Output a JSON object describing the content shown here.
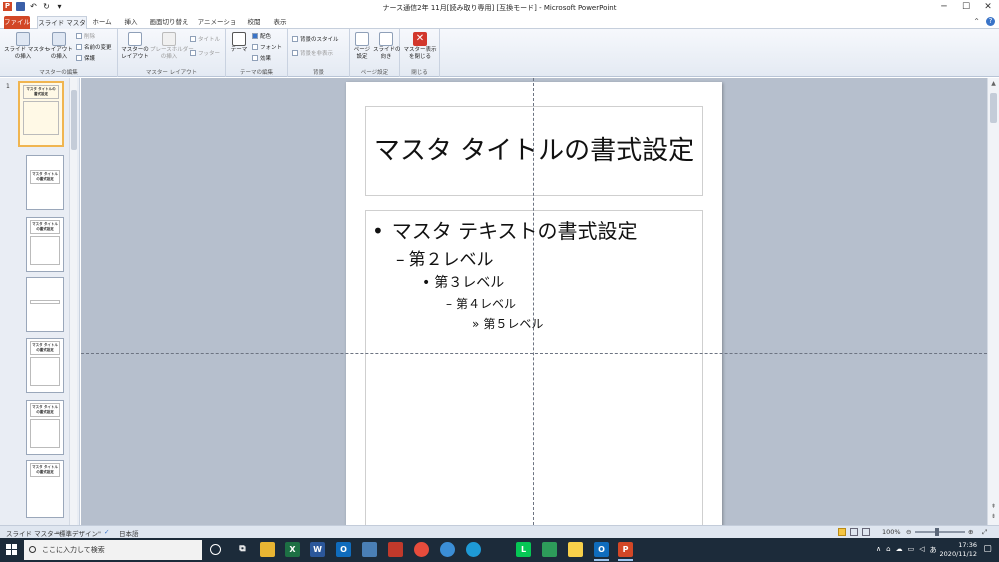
{
  "window": {
    "title": "ナース通信2年 11月[読み取り専用] [互換モード] - Microsoft PowerPoint",
    "controls": [
      "minimize",
      "maximize",
      "close"
    ]
  },
  "tabs": [
    {
      "label": "ファイル",
      "type": "file"
    },
    {
      "label": "スライド マスター",
      "type": "active"
    },
    {
      "label": "ホーム"
    },
    {
      "label": "挿入"
    },
    {
      "label": "画面切り替え"
    },
    {
      "label": "アニメーション"
    },
    {
      "label": "校閲"
    },
    {
      "label": "表示"
    }
  ],
  "ribbon": {
    "groups": [
      {
        "label": "マスターの編集"
      },
      {
        "label": "マスター レイアウト"
      },
      {
        "label": "テーマの編集"
      },
      {
        "label": "背景"
      },
      {
        "label": "ページ設定"
      },
      {
        "label": "閉じる"
      }
    ],
    "insert_slide_master": "スライド マスター\nの挿入",
    "insert_layout": "レイアウト\nの挿入",
    "delete": "削除",
    "rename": "名前の変更",
    "preserve": "保護",
    "master_layout": "マスターの\nレイアウト",
    "insert_placeholder": "プレースホルダー\nの挿入",
    "title_check": "タイトル",
    "footer_check": "フッター",
    "themes": "テーマ",
    "colors": "配色",
    "fonts": "フォント",
    "effects": "効果",
    "background_styles": "背景のスタイル",
    "hide_background": "背景を非表示",
    "page_setup": "ページ\n設定",
    "slide_orientation": "スライドの\n向き",
    "close_master": "マスター表示\nを閉じる"
  },
  "thumbnails": [
    {
      "number": "1",
      "title": "マスタ タイトルの書式設定",
      "selected": true
    },
    {
      "title": "マスタ タイトルの書式設定"
    },
    {
      "title": "マスタ タイトルの書式設定"
    },
    {
      "title": ""
    },
    {
      "title": "マスタ タイトルの書式設定"
    },
    {
      "title": "マスタ タイトルの書式設定"
    },
    {
      "title": "マスタ タイトルの書式設定"
    }
  ],
  "slide": {
    "title": "マスタ タイトルの書式設定",
    "levels": [
      {
        "bullet": "•",
        "text": "マスタ テキストの書式設定"
      },
      {
        "bullet": "–",
        "text": "第２レベル"
      },
      {
        "bullet": "•",
        "text": "第３レベル"
      },
      {
        "bullet": "–",
        "text": "第４レベル"
      },
      {
        "bullet": "»",
        "text": "第５レベル"
      }
    ]
  },
  "statusbar": {
    "view": "スライド マスター",
    "theme": "\"標準デザイン\"",
    "language": "日本語",
    "zoom": "100%"
  },
  "taskbar": {
    "search_placeholder": "ここに入力して検索",
    "apps": [
      "cortana-icon",
      "taskview-icon",
      "explorer-icon",
      "excel-icon",
      "word-icon",
      "outlook-icon",
      "store-icon",
      "acrobat-icon",
      "chrome-icon",
      "edge-legacy-icon",
      "edge-icon",
      "line-icon",
      "app-icon",
      "sticky-icon",
      "outlook2-icon",
      "powerpoint-icon"
    ],
    "ime": "あ",
    "time": "17:36",
    "date": "2020/11/12"
  },
  "colors": {
    "file_tab": "#d24726",
    "taskbar": "#1c2b3a",
    "selected_thumb": "#f0b550"
  }
}
